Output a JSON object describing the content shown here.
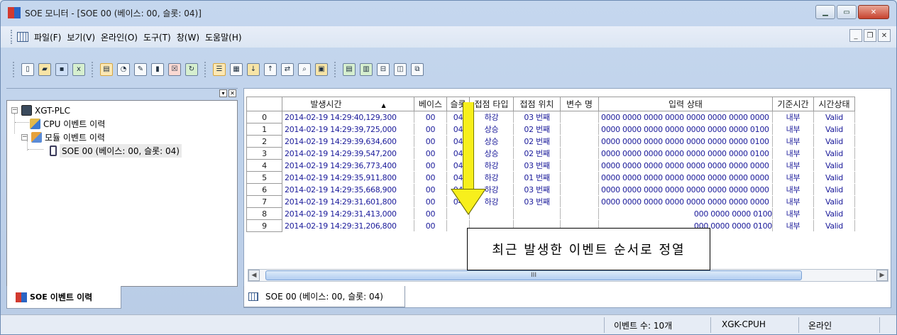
{
  "window": {
    "title": "SOE 모니터 - [SOE 00 (베이스: 00, 슬롯: 04)]"
  },
  "menu": [
    "파일(F)",
    "보기(V)",
    "온라인(O)",
    "도구(T)",
    "창(W)",
    "도움말(H)"
  ],
  "tree": {
    "root": "XGT-PLC",
    "cpu": "CPU 이벤트 이력",
    "module": "모듈 이벤트 이력",
    "soe": "SOE 00 (베이스: 00, 슬롯: 04)"
  },
  "left_tab": {
    "prefix": "SOE",
    "label": "이벤트 이력"
  },
  "grid": {
    "headers": [
      "발생시간",
      "베이스",
      "슬롯",
      "접점 타입",
      "접점 위치",
      "변수 명",
      "입력 상태",
      "기준시간",
      "시간상태"
    ],
    "sort_indicator": "▲",
    "rows": [
      [
        "0",
        "2014-02-19 14:29:40,129,300",
        "00",
        "04",
        "하강",
        "03 번째",
        "",
        "0000 0000 0000 0000 0000 0000 0000 0000",
        "내부",
        "Valid"
      ],
      [
        "1",
        "2014-02-19 14:29:39,725,000",
        "00",
        "04",
        "상승",
        "02 번째",
        "",
        "0000 0000 0000 0000 0000 0000 0000 0100",
        "내부",
        "Valid"
      ],
      [
        "2",
        "2014-02-19 14:29:39,634,600",
        "00",
        "04",
        "상승",
        "02 번째",
        "",
        "0000 0000 0000 0000 0000 0000 0000 0100",
        "내부",
        "Valid"
      ],
      [
        "3",
        "2014-02-19 14:29:39,547,200",
        "00",
        "04",
        "상승",
        "02 번째",
        "",
        "0000 0000 0000 0000 0000 0000 0000 0100",
        "내부",
        "Valid"
      ],
      [
        "4",
        "2014-02-19 14:29:36,773,400",
        "00",
        "04",
        "하강",
        "03 번째",
        "",
        "0000 0000 0000 0000 0000 0000 0000 0000",
        "내부",
        "Valid"
      ],
      [
        "5",
        "2014-02-19 14:29:35,911,800",
        "00",
        "04",
        "하강",
        "01 번째",
        "",
        "0000 0000 0000 0000 0000 0000 0000 0000",
        "내부",
        "Valid"
      ],
      [
        "6",
        "2014-02-19 14:29:35,668,900",
        "00",
        "04",
        "하강",
        "03 번째",
        "",
        "0000 0000 0000 0000 0000 0000 0000 0000",
        "내부",
        "Valid"
      ],
      [
        "7",
        "2014-02-19 14:29:31,601,800",
        "00",
        "04",
        "하강",
        "03 번째",
        "",
        "0000 0000 0000 0000 0000 0000 0000 0000",
        "내부",
        "Valid"
      ],
      [
        "8",
        "2014-02-19 14:29:31,413,000",
        "00",
        "",
        "",
        "",
        "",
        "000 0000 0000 0100",
        "내부",
        "Valid"
      ],
      [
        "9",
        "2014-02-19 14:29:31,206,800",
        "00",
        "",
        "",
        "",
        "",
        "000 0000 0000 0100",
        "내부",
        "Valid"
      ]
    ]
  },
  "scroll_thumb": "III",
  "doc_tab": "SOE 00 (베이스: 00, 슬롯: 04)",
  "callout": "최근 발생한 이벤트 순서로 정열",
  "status": {
    "events": "이벤트 수: 10개",
    "cpu": "XGK-CPUH",
    "mode": "온라인"
  },
  "colors": {
    "arrow": "#f7ef1c",
    "cell_text": "#1a1a9a"
  }
}
